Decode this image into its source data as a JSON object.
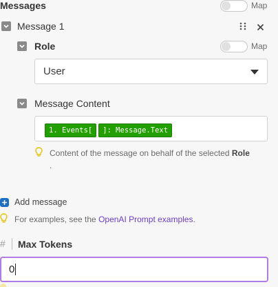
{
  "messages_section": {
    "title": "Messages",
    "map_label": "Map"
  },
  "message_item": {
    "label": "Message 1",
    "drag_icon": "drag-handle-icon",
    "close_icon": "close-icon"
  },
  "role": {
    "label": "Role",
    "map_label": "Map",
    "selected_value": "User"
  },
  "message_content": {
    "label": "Message Content",
    "tokens": [
      "1. Events[",
      "]: Message.Text"
    ],
    "hint_prefix": "Content of the message on behalf of the selected",
    "hint_bold": "Role",
    "hint_suffix": "."
  },
  "add_message": {
    "label": "Add message"
  },
  "examples_hint": {
    "prefix": "For examples, see the",
    "link_text": "OpenAI Prompt examples",
    "suffix": "."
  },
  "max_tokens": {
    "icon": "#",
    "label": "Max Tokens",
    "value": "0"
  },
  "colors": {
    "accent_purple": "#b07be6",
    "token_green": "#22a000",
    "link_purple": "#6b3fc8",
    "add_blue": "#1c6fc2",
    "bulb_yellow": "#e6c200"
  }
}
